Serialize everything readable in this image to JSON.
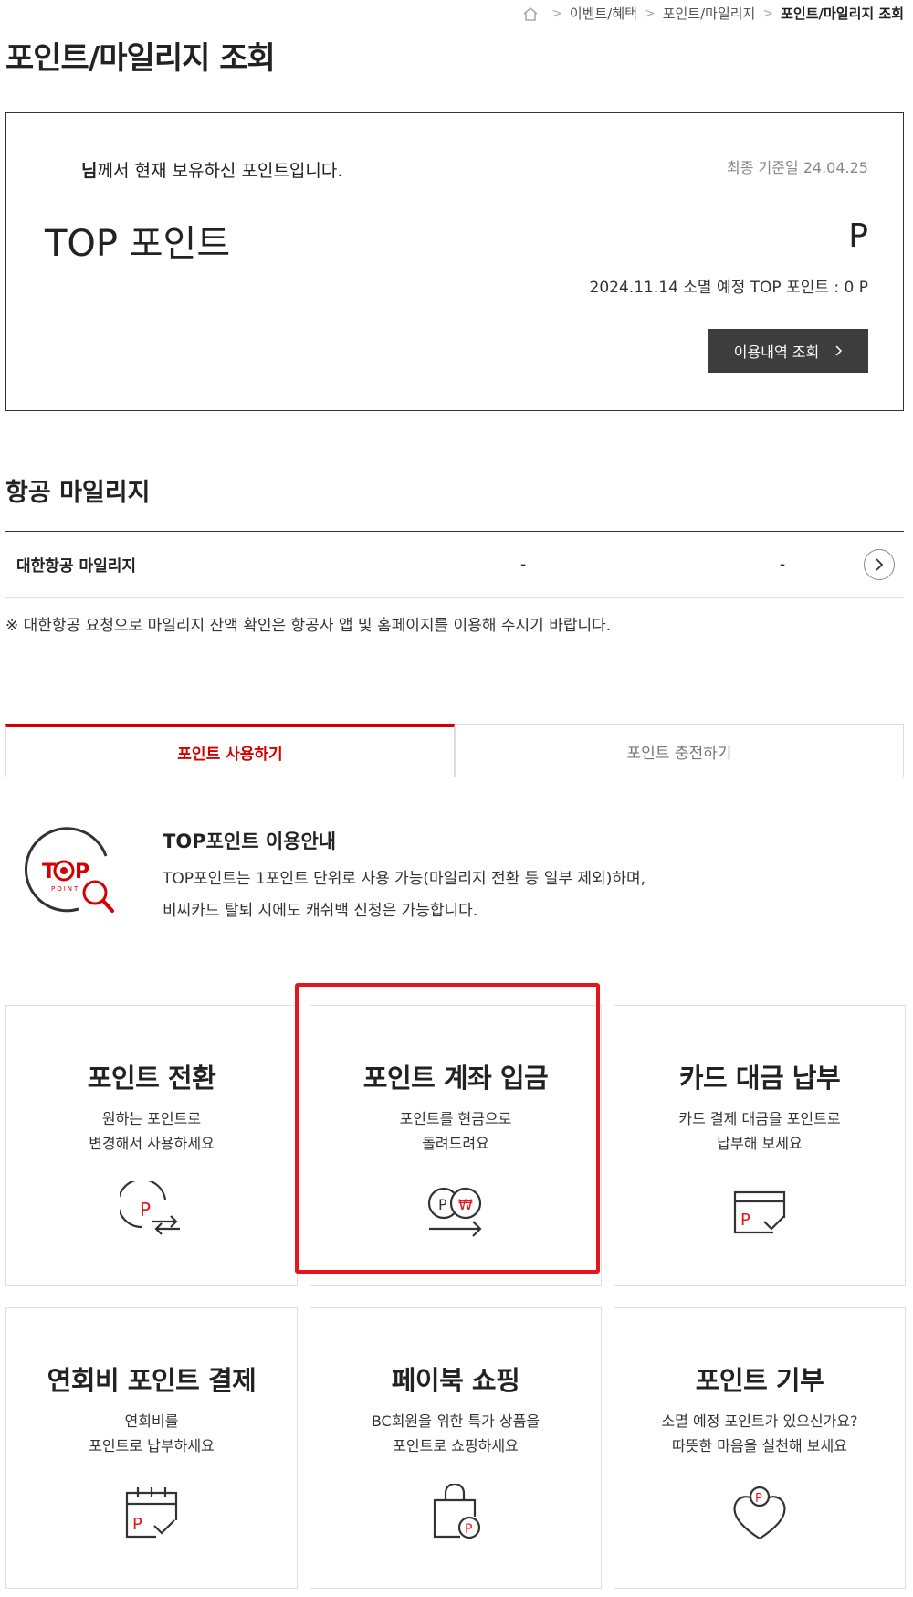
{
  "breadcrumb": {
    "items": [
      "이벤트/혜택",
      "포인트/마일리지",
      "포인트/마일리지 조회"
    ]
  },
  "page": {
    "title": "포인트/마일리지 조회"
  },
  "point_box": {
    "owner_suffix": "님께서 현재 보유하신 포인트입니다.",
    "base_date": "최종 기준일 24.04.25",
    "top_label": "TOP 포인트",
    "point_unit": "P",
    "expire_text": "2024.11.14 소멸 예정 TOP 포인트 : 0 P",
    "history_button": "이용내역 조회"
  },
  "mileage": {
    "title": "항공 마일리지",
    "row": {
      "name": "대한항공 마일리지",
      "value1": "-",
      "value2": "-"
    },
    "note": "※ 대한항공 요청으로 마일리지 잔액 확인은 항공사 앱 및 홈페이지를 이용해 주시기 바랍니다."
  },
  "tabs": [
    {
      "label": "포인트 사용하기",
      "active": true
    },
    {
      "label": "포인트 충전하기",
      "active": false
    }
  ],
  "info": {
    "logo_text": "TOP",
    "logo_sub": "POINT",
    "title": "TOP포인트 이용안내",
    "desc_line1": "TOP포인트는 1포인트 단위로 사용 가능(마일리지 전환 등 일부 제외)하며,",
    "desc_line2": "비씨카드 탈퇴 시에도 캐쉬백 신청은 가능합니다."
  },
  "cards": [
    {
      "title": "포인트 전환",
      "desc1": "원하는 포인트로",
      "desc2": "변경해서 사용하세요",
      "icon": "point-exchange-icon"
    },
    {
      "title": "포인트 계좌 입금",
      "desc1": "포인트를 현금으로",
      "desc2": "돌려드려요",
      "icon": "point-to-cash-icon"
    },
    {
      "title": "카드 대금 납부",
      "desc1": "카드 결제 대금을 포인트로",
      "desc2": "납부해 보세요",
      "icon": "card-payment-icon"
    },
    {
      "title": "연회비 포인트 결제",
      "desc1": "연회비를",
      "desc2": "포인트로 납부하세요",
      "icon": "calendar-payment-icon"
    },
    {
      "title": "페이북 쇼핑",
      "desc1": "BC회원을 위한 특가 상품을",
      "desc2": "포인트로 쇼핑하세요",
      "icon": "shopping-bag-icon"
    },
    {
      "title": "포인트 기부",
      "desc1": "소멸 예정 포인트가 있으신가요?",
      "desc2": "따뜻한 마음을 실천해 보세요",
      "icon": "heart-donation-icon"
    }
  ],
  "colors": {
    "accent": "#e8141c",
    "tab_active": "#d40000",
    "button_dark": "#3d3d3d"
  }
}
